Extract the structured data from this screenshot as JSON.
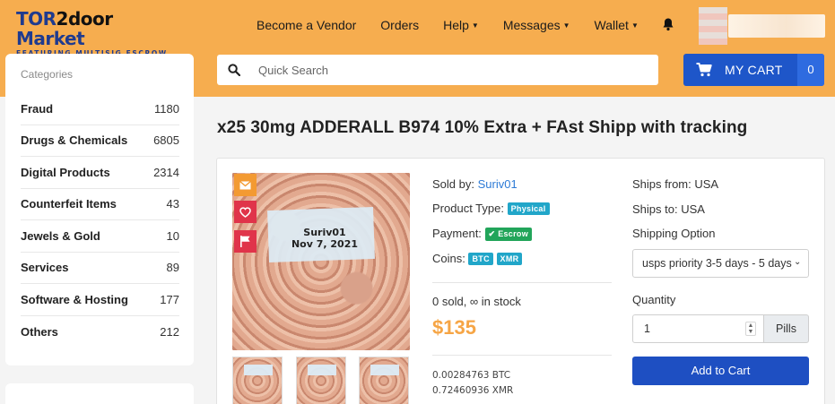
{
  "brand": {
    "logo_main_a": "TOR",
    "logo_main_b": "2door",
    "logo_main_c": " Market",
    "logo_sub": "FEATURING MULTISIG ESCROW"
  },
  "nav": {
    "become_vendor": "Become a Vendor",
    "orders": "Orders",
    "help": "Help",
    "messages": "Messages",
    "wallet": "Wallet"
  },
  "search": {
    "placeholder": "Quick Search"
  },
  "cart": {
    "label": "MY CART",
    "count": "0"
  },
  "sidebar": {
    "title": "Categories",
    "items": [
      {
        "label": "Fraud",
        "count": "1180"
      },
      {
        "label": "Drugs & Chemicals",
        "count": "6805"
      },
      {
        "label": "Digital Products",
        "count": "2314"
      },
      {
        "label": "Counterfeit Items",
        "count": "43"
      },
      {
        "label": "Jewels & Gold",
        "count": "10"
      },
      {
        "label": "Services",
        "count": "89"
      },
      {
        "label": "Software & Hosting",
        "count": "177"
      },
      {
        "label": "Others",
        "count": "212"
      }
    ]
  },
  "product": {
    "title": "x25 30mg ADDERALL B974 10% Extra + FAst Shipp with tracking",
    "image_caption_line1": "Suriv01",
    "image_caption_line2": "Nov 7, 2021",
    "sold_by_label": "Sold by:",
    "seller": "Suriv01",
    "type_label": "Product Type:",
    "type_badge": "Physical",
    "payment_label": "Payment:",
    "payment_badge": "✔ Escrow",
    "coins_label": "Coins:",
    "coin_btc": "BTC",
    "coin_xmr": "XMR",
    "stock": "0 sold, ∞ in stock",
    "price": "$135",
    "price_btc": "0.00284763 BTC",
    "price_xmr": "0.72460936 XMR",
    "ships_from": "Ships from: USA",
    "ships_to": "Ships to: USA",
    "shipping_option_label": "Shipping Option",
    "shipping_option_value": "usps priority 3-5 days - 5 days",
    "quantity_label": "Quantity",
    "quantity_value": "1",
    "quantity_unit": "Pills",
    "add_to_cart": "Add to Cart"
  },
  "colors": {
    "header_orange": "#f6ad4f",
    "primary_blue": "#1e56c9",
    "price_orange": "#f6a545",
    "link_blue": "#2e7bd6"
  },
  "icons": [
    "search-icon",
    "cart-icon",
    "bell-icon",
    "mail-icon",
    "heart-icon",
    "flag-icon",
    "chevron-down-icon"
  ]
}
